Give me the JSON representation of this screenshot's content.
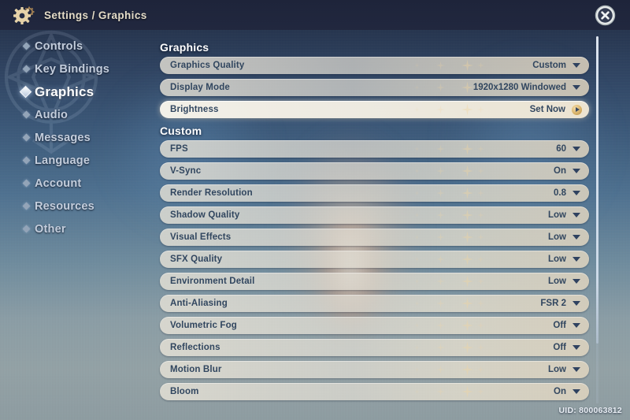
{
  "header": {
    "gear_icon": "gear-icon",
    "breadcrumb": "Settings / Graphics",
    "close_icon": "close-icon"
  },
  "sidebar": {
    "items": [
      {
        "label": "Controls",
        "active": false
      },
      {
        "label": "Key Bindings",
        "active": false
      },
      {
        "label": "Graphics",
        "active": true
      },
      {
        "label": "Audio",
        "active": false
      },
      {
        "label": "Messages",
        "active": false
      },
      {
        "label": "Language",
        "active": false
      },
      {
        "label": "Account",
        "active": false
      },
      {
        "label": "Resources",
        "active": false
      },
      {
        "label": "Other",
        "active": false
      }
    ]
  },
  "content": {
    "sections": [
      {
        "title": "Graphics",
        "rows": [
          {
            "label": "Graphics Quality",
            "value": "Custom",
            "control": "chevron-down-icon",
            "highlight": false
          },
          {
            "label": "Display Mode",
            "value": "1920x1280 Windowed",
            "control": "chevron-down-icon",
            "highlight": false
          },
          {
            "label": "Brightness",
            "value": "Set Now",
            "control": "play-button-icon",
            "highlight": true
          }
        ]
      },
      {
        "title": "Custom",
        "rows": [
          {
            "label": "FPS",
            "value": "60",
            "control": "chevron-down-icon",
            "highlight": false
          },
          {
            "label": "V-Sync",
            "value": "On",
            "control": "chevron-down-icon",
            "highlight": false
          },
          {
            "label": "Render Resolution",
            "value": "0.8",
            "control": "chevron-down-icon",
            "highlight": false
          },
          {
            "label": "Shadow Quality",
            "value": "Low",
            "control": "chevron-down-icon",
            "highlight": false
          },
          {
            "label": "Visual Effects",
            "value": "Low",
            "control": "chevron-down-icon",
            "highlight": false
          },
          {
            "label": "SFX Quality",
            "value": "Low",
            "control": "chevron-down-icon",
            "highlight": false
          },
          {
            "label": "Environment Detail",
            "value": "Low",
            "control": "chevron-down-icon",
            "highlight": false
          },
          {
            "label": "Anti-Aliasing",
            "value": "FSR 2",
            "control": "chevron-down-icon",
            "highlight": false
          },
          {
            "label": "Volumetric Fog",
            "value": "Off",
            "control": "chevron-down-icon",
            "highlight": false
          },
          {
            "label": "Reflections",
            "value": "Off",
            "control": "chevron-down-icon",
            "highlight": false
          },
          {
            "label": "Motion Blur",
            "value": "Low",
            "control": "chevron-down-icon",
            "highlight": false
          },
          {
            "label": "Bloom",
            "value": "On",
            "control": "chevron-down-icon",
            "highlight": false
          }
        ]
      }
    ]
  },
  "footer": {
    "uid": "UID: 800063812"
  },
  "colors": {
    "accent_gold": "#d9b36a",
    "row_text": "#31465f",
    "header_bar": "#1f2740",
    "active_nav": "#ffffff"
  }
}
